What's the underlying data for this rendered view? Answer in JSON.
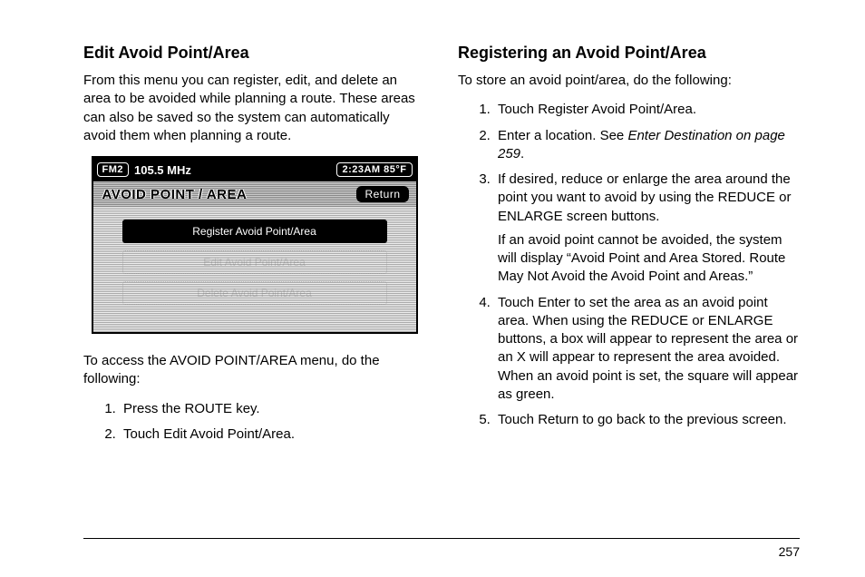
{
  "left": {
    "heading": "Edit Avoid Point/Area",
    "intro": "From this menu you can register, edit, and delete an area to be avoided while planning a route. These areas can also be saved so the system can automatically avoid them when planning a route.",
    "access_intro": "To access the AVOID POINT/AREA menu, do the following:",
    "steps": [
      "Press the ROUTE key.",
      "Touch Edit Avoid Point/Area."
    ]
  },
  "device": {
    "radio_band": "FM2",
    "frequency": "105.5 MHz",
    "time_temp": "2:23AM 85°F",
    "screen_title": "AVOID POINT / AREA",
    "return_label": "Return",
    "menu_items": [
      {
        "label": "Register Avoid Point/Area",
        "active": true
      },
      {
        "label": "Edit Avoid Point/Area",
        "active": false
      },
      {
        "label": "Delete Avoid Point/Area",
        "active": false
      }
    ]
  },
  "right": {
    "heading": "Registering an Avoid Point/Area",
    "intro": "To store an avoid point/area, do the following:",
    "steps": {
      "s1": "Touch Register Avoid Point/Area.",
      "s2a": "Enter a location. See ",
      "s2b_italic": "Enter Destination on page 259",
      "s2c": ".",
      "s3a": "If desired, reduce or enlarge the area around the point you want to avoid by using the REDUCE or ENLARGE screen buttons.",
      "s3b": "If an avoid point cannot be avoided, the system will display “Avoid Point and Area Stored. Route May Not Avoid the Avoid Point and Areas.”",
      "s4": "Touch Enter to set the area as an avoid point area. When using the REDUCE or ENLARGE buttons, a box will appear to represent the area or an X will appear to represent the area avoided. When an avoid point is set, the square will appear as green.",
      "s5": "Touch Return to go back to the previous screen."
    }
  },
  "page_number": "257"
}
